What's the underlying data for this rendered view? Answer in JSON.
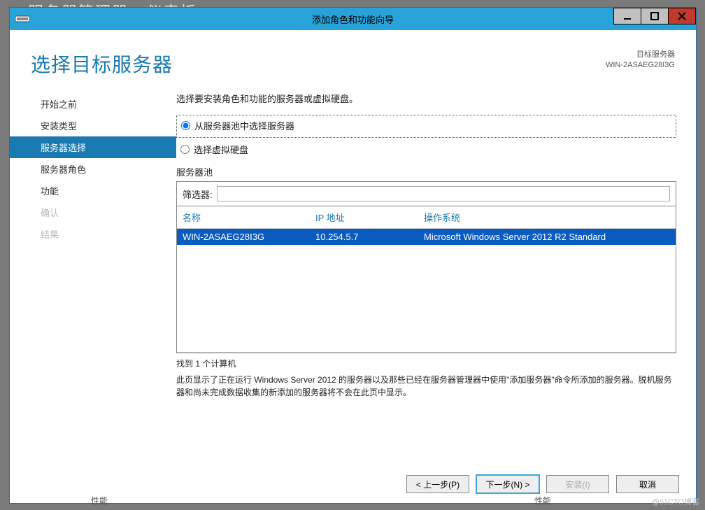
{
  "bg_fragment": "服务器管理器 · 仪表板",
  "window": {
    "title": "添加角色和功能向导"
  },
  "header": {
    "page_title": "选择目标服务器",
    "dest_label": "目标服务器",
    "dest_name": "WIN-2ASAEG28I3G"
  },
  "sidebar": {
    "items": [
      {
        "label": "开始之前",
        "state": "normal"
      },
      {
        "label": "安装类型",
        "state": "normal"
      },
      {
        "label": "服务器选择",
        "state": "active"
      },
      {
        "label": "服务器角色",
        "state": "normal"
      },
      {
        "label": "功能",
        "state": "normal"
      },
      {
        "label": "确认",
        "state": "disabled"
      },
      {
        "label": "结果",
        "state": "disabled"
      }
    ]
  },
  "main": {
    "instruction": "选择要安装角色和功能的服务器或虚拟硬盘。",
    "radio": {
      "opt1": "从服务器池中选择服务器",
      "opt2": "选择虚拟硬盘"
    },
    "pool_label": "服务器池",
    "filter_label": "筛选器:",
    "filter_value": "",
    "columns": {
      "name": "名称",
      "ip": "IP 地址",
      "os": "操作系统"
    },
    "rows": [
      {
        "name": "WIN-2ASAEG28I3G",
        "ip": "10.254.5.7",
        "os": "Microsoft Windows Server 2012 R2 Standard"
      }
    ],
    "found": "找到 1 个计算机",
    "note": "此页显示了正在运行 Windows Server 2012 的服务器以及那些已经在服务器管理器中使用\"添加服务器\"命令所添加的服务器。脱机服务器和尚未完成数据收集的新添加的服务器将不会在此页中显示。"
  },
  "footer": {
    "prev": "< 上一步(P)",
    "next": "下一步(N) >",
    "install": "安装(I)",
    "cancel": "取消"
  },
  "watermark": "@51CTO博客",
  "bottom_strip": {
    "left": "性能",
    "right": "性能"
  }
}
